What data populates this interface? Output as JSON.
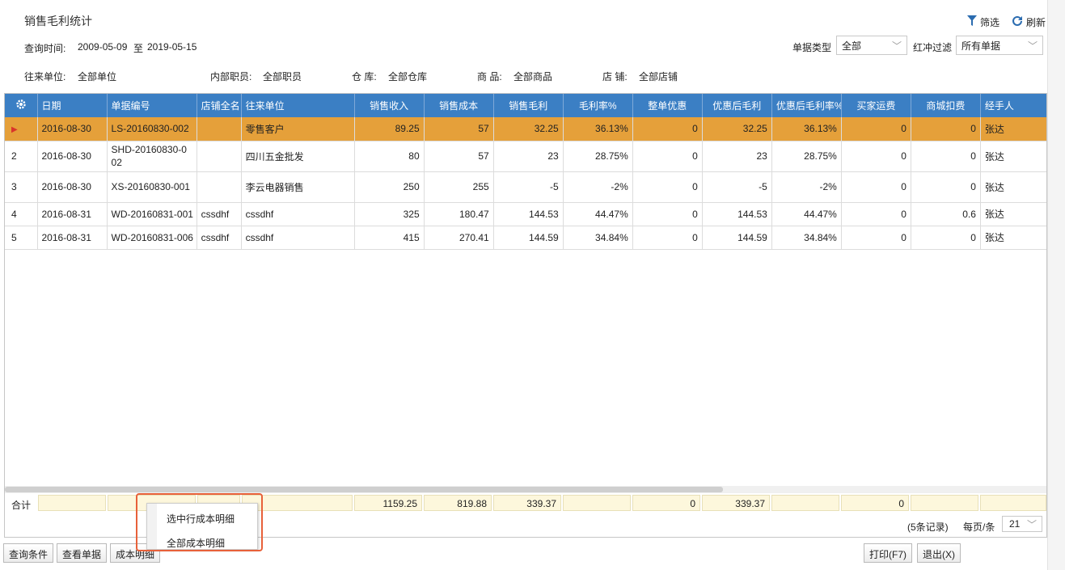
{
  "title": "销售毛利统计",
  "toolbar": {
    "filter_label": "筛选",
    "refresh_label": "刷新"
  },
  "query": {
    "time_label": "查询时间:",
    "date_from": "2009-05-09",
    "date_to_sep": "至",
    "date_to": "2019-05-15",
    "doc_type_label": "单据类型",
    "doc_type_value": "全部",
    "hongchong_label": "红冲过滤",
    "hongchong_value": "所有单据"
  },
  "filters": {
    "partner_label": "往来单位:",
    "partner_value": "全部单位",
    "staff_label": "内部职员:",
    "staff_value": "全部职员",
    "warehouse_label": "仓 库:",
    "warehouse_value": "全部仓库",
    "goods_label": "商 品:",
    "goods_value": "全部商品",
    "shop_label": "店 铺:",
    "shop_value": "全部店铺"
  },
  "grid": {
    "columns": [
      "日期",
      "单据编号",
      "店铺全名",
      "往来单位",
      "销售收入",
      "销售成本",
      "销售毛利",
      "毛利率%",
      "整单优惠",
      "优惠后毛利",
      "优惠后毛利率%",
      "买家运费",
      "商城扣费",
      "经手人"
    ],
    "rows": [
      {
        "no": "",
        "date": "2016-08-30",
        "doc": "LS-20160830-002",
        "shop": "",
        "partner": "零售客户",
        "revenue": "89.25",
        "cost": "57",
        "profit": "32.25",
        "rate": "36.13%",
        "discount": "0",
        "profit_after": "32.25",
        "rate_after": "36.13%",
        "freight": "0",
        "fee": "0",
        "handler": "张达"
      },
      {
        "no": "2",
        "date": "2016-08-30",
        "doc": "SHD-20160830-002",
        "shop": "",
        "partner": "四川五金批发",
        "revenue": "80",
        "cost": "57",
        "profit": "23",
        "rate": "28.75%",
        "discount": "0",
        "profit_after": "23",
        "rate_after": "28.75%",
        "freight": "0",
        "fee": "0",
        "handler": "张达"
      },
      {
        "no": "3",
        "date": "2016-08-30",
        "doc": "XS-20160830-001",
        "shop": "",
        "partner": "李云电器销售",
        "revenue": "250",
        "cost": "255",
        "profit": "-5",
        "rate": "-2%",
        "discount": "0",
        "profit_after": "-5",
        "rate_after": "-2%",
        "freight": "0",
        "fee": "0",
        "handler": "张达"
      },
      {
        "no": "4",
        "date": "2016-08-31",
        "doc": "WD-20160831-001",
        "shop": "cssdhf",
        "partner": "cssdhf",
        "revenue": "325",
        "cost": "180.47",
        "profit": "144.53",
        "rate": "44.47%",
        "discount": "0",
        "profit_after": "144.53",
        "rate_after": "44.47%",
        "freight": "0",
        "fee": "0.6",
        "handler": "张达"
      },
      {
        "no": "5",
        "date": "2016-08-31",
        "doc": "WD-20160831-006",
        "shop": "cssdhf",
        "partner": "cssdhf",
        "revenue": "415",
        "cost": "270.41",
        "profit": "144.59",
        "rate": "34.84%",
        "discount": "0",
        "profit_after": "144.59",
        "rate_after": "34.84%",
        "freight": "0",
        "fee": "0",
        "handler": "张达"
      }
    ],
    "totals": {
      "label": "合计",
      "revenue": "1159.25",
      "cost": "819.88",
      "profit": "339.37",
      "discount": "0",
      "profit_after": "339.37",
      "freight": "0"
    }
  },
  "pager": {
    "records": "(5条记录)",
    "per_page_label": "每页/条",
    "per_page_value": "21"
  },
  "context_menu": {
    "item1": "选中行成本明细",
    "item2": "全部成本明细"
  },
  "buttons": {
    "query_cond": "查询条件",
    "view_doc": "查看单据",
    "cost_detail": "成本明细",
    "print": "打印(F7)",
    "exit": "退出(X)"
  },
  "colors": {
    "header_bg": "#3b7fc4",
    "selected_row": "#e5a03a",
    "popup_border": "#e8613a"
  }
}
